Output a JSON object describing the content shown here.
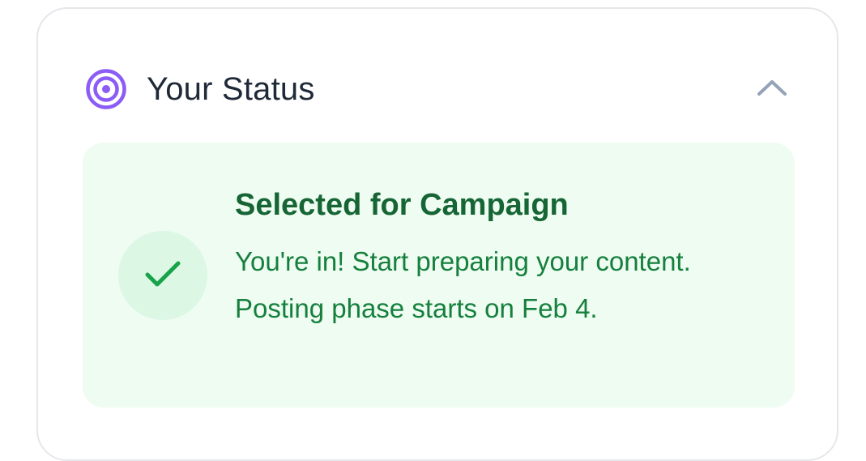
{
  "header": {
    "title": "Your Status",
    "icon": "target-icon",
    "collapse_icon": "chevron-up-icon"
  },
  "status": {
    "icon": "check-icon",
    "title": "Selected for Campaign",
    "description": "You're in! Start preparing your content. Posting phase starts on Feb 4."
  },
  "colors": {
    "accent_purple": "#8b5cf6",
    "success_green": "#16a34a",
    "panel_background": "#effcf2"
  }
}
